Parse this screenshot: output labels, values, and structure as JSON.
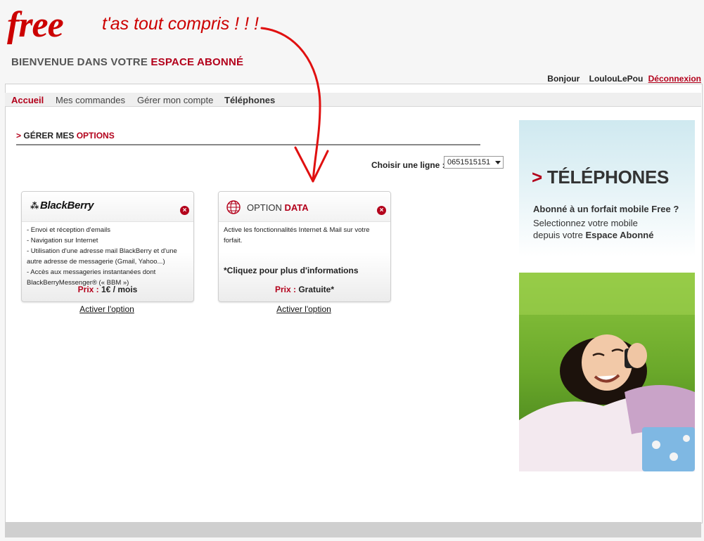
{
  "header": {
    "logo": "free",
    "tagline": "t'as tout compris ! ! !",
    "welcome_prefix": "BIENVENUE DANS VOTRE ",
    "welcome_accent": "ESPACE ABONNÉ"
  },
  "user": {
    "greeting": "Bonjour",
    "username": "LoulouLePou",
    "logout": "Déconnexion"
  },
  "nav": {
    "items": [
      {
        "label": "Accueil"
      },
      {
        "label": "Mes commandes"
      },
      {
        "label": "Gérer mon compte"
      },
      {
        "label": "Téléphones"
      }
    ]
  },
  "section": {
    "arrow": ">",
    "title_prefix": "GÉRER MES ",
    "title_accent": "OPTIONS"
  },
  "line_chooser": {
    "label": "Choisir une ligne :",
    "value": "0651515151"
  },
  "cards": [
    {
      "brand": "BlackBerry",
      "lines": [
        "- Envoi et réception d'emails",
        "- Navigation sur Internet",
        "- Utilisation d'une adresse mail BlackBerry et d'une",
        "autre adresse de messagerie (Gmail, Yahoo...)",
        "- Accès aux messageries instantanées dont",
        "BlackBerryMessenger® (« BBM »)"
      ],
      "price_label": "Prix :",
      "price_value": "1€ / mois",
      "activate": "Activer l'option"
    },
    {
      "title_prefix": "OPTION ",
      "title_accent": "DATA",
      "lines": [
        "Active les fonctionnalités Internet & Mail sur votre",
        "forfait."
      ],
      "more": "*Cliquez pour plus d'informations",
      "price_label": "Prix :",
      "price_value": "Gratuite*",
      "activate": "Activer l'option"
    }
  ],
  "promo": {
    "arrow": ">",
    "title": "TÉLÉPHONES",
    "question": "Abonné à un forfait mobile Free ?",
    "line1": "Selectionnez votre mobile",
    "line2_prefix": "depuis votre ",
    "line2_bold": "Espace Abonné"
  },
  "colors": {
    "brand_red": "#cc0000",
    "accent_red": "#b3001b"
  }
}
